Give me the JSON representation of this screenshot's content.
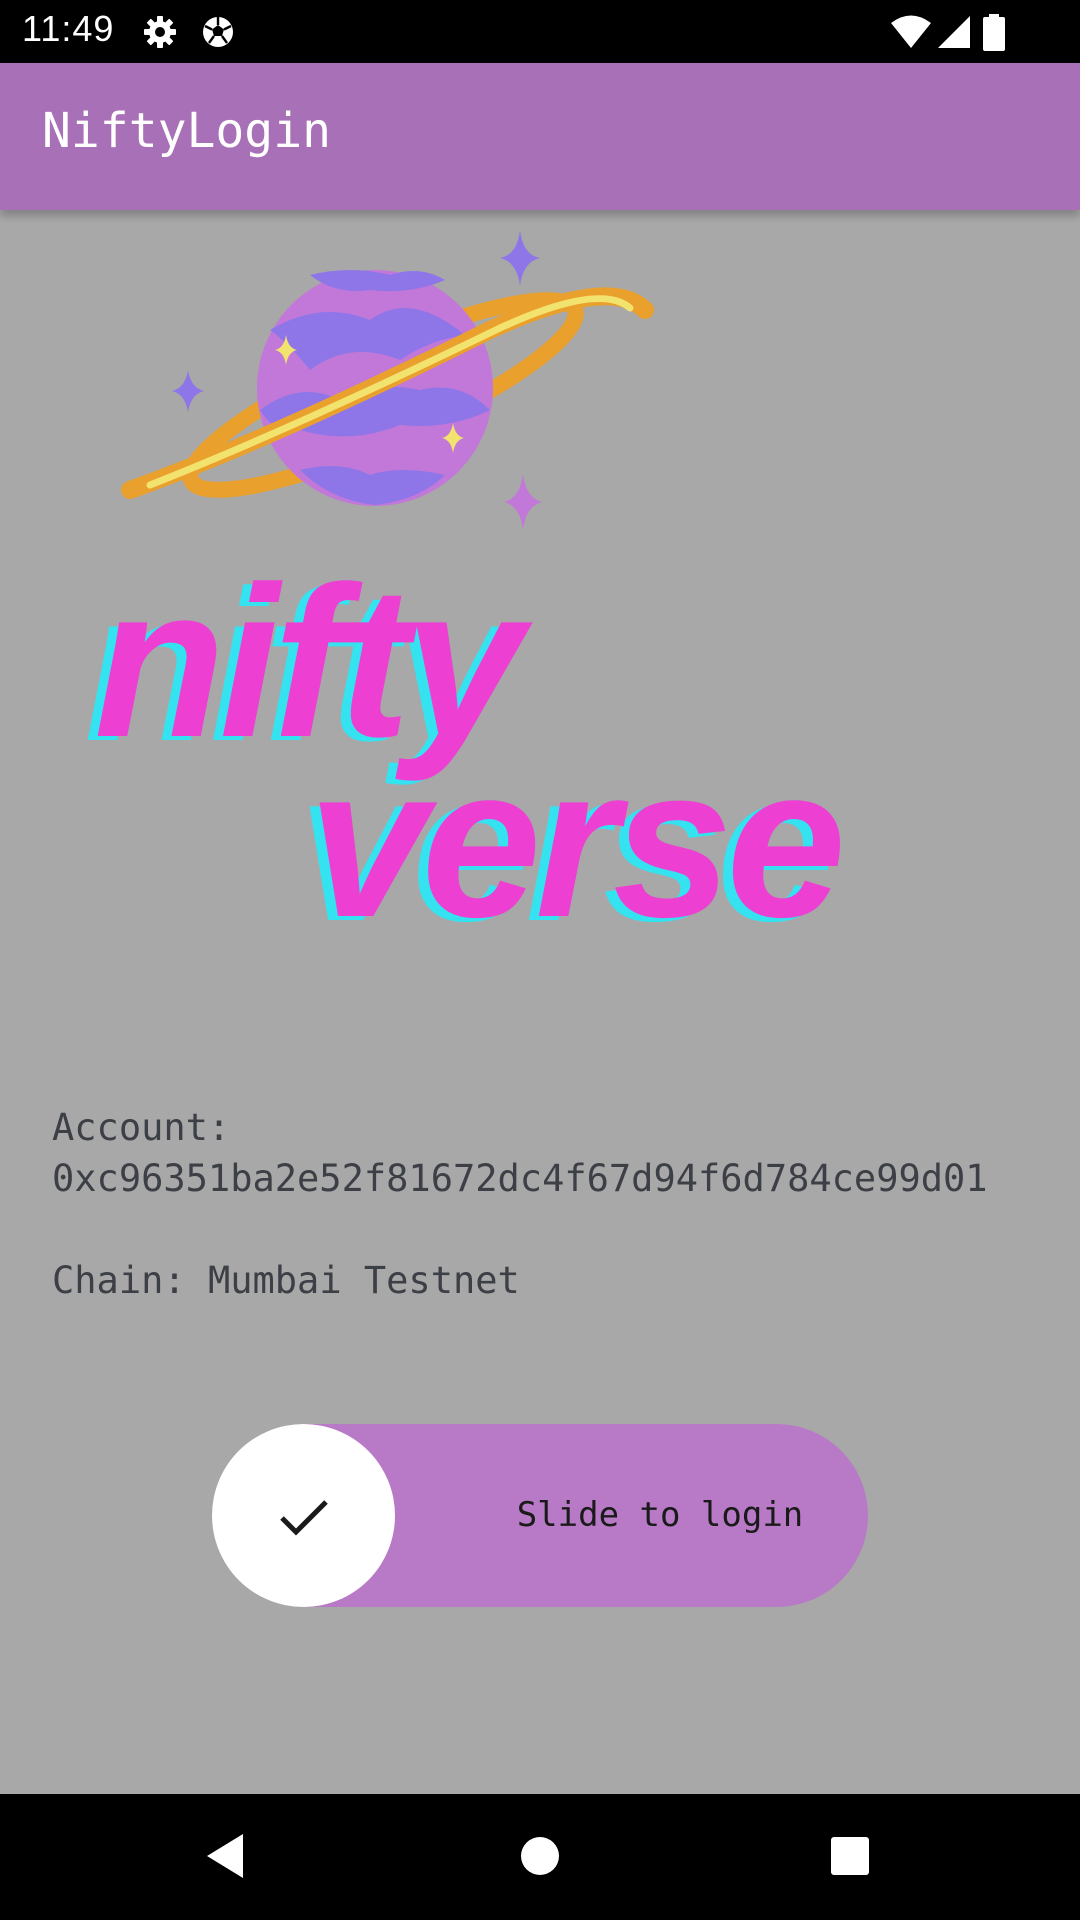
{
  "status_bar": {
    "time": "11:49",
    "icons": [
      "gear-icon",
      "soccer-ball-icon",
      "wifi-icon",
      "signal-icon",
      "battery-icon"
    ]
  },
  "app_bar": {
    "title": "NiftyLogin",
    "color": "#a870b6"
  },
  "logo": {
    "text_line1": "nifty",
    "text_line2": "verse",
    "text_color": "#ee3fd3",
    "shadow_color": "#35e2f0",
    "planet_color": "#c278d8",
    "planet_stripe_color": "#8f76e8",
    "ring_color": "#eaa02d",
    "ring_inner_color": "#f2e36e"
  },
  "account": {
    "label": "Account:",
    "value": "0xc96351ba2e52f81672dc4f67d94f6d784ce99d01"
  },
  "chain": {
    "label": "Chain:",
    "value": "Mumbai Testnet"
  },
  "slider": {
    "label": "Slide to login",
    "track_color": "#b87ac6",
    "knob_icon": "checkmark-icon"
  },
  "nav_bar": {
    "buttons": [
      "back-icon",
      "home-icon",
      "recents-icon"
    ]
  }
}
